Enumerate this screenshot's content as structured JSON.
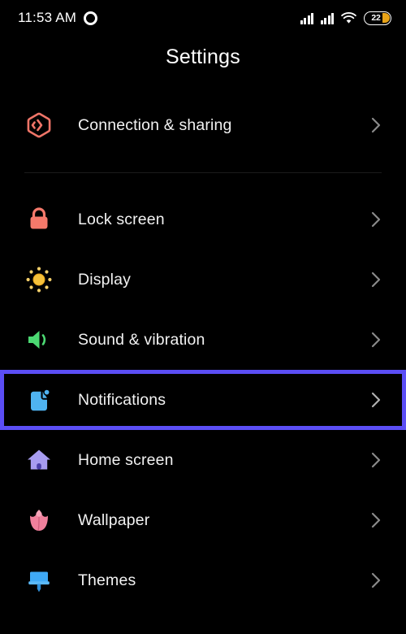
{
  "statusbar": {
    "time": "11:53 AM",
    "camera_icon": "camera-punch-hole-icon",
    "signal1_icon": "cellular-signal-icon",
    "signal2_icon": "cellular-signal-icon",
    "wifi_icon": "wifi-icon",
    "battery_level": "22",
    "battery_icon": "battery-icon",
    "battery_color": "#e8a317"
  },
  "header": {
    "title": "Settings"
  },
  "theme": {
    "background": "#000000",
    "text": "#f2f2f2",
    "highlight": "#5b4ef5",
    "divider": "#1b1b1b",
    "chevron": "#8a8a8a"
  },
  "list": {
    "groups": [
      {
        "items": [
          {
            "label": "Connection & sharing",
            "icon": "connection-sharing-icon",
            "icon_color": "#ef7568",
            "chevron": "chevron-right-icon",
            "selected": false
          }
        ]
      },
      {
        "items": [
          {
            "label": "Lock screen",
            "icon": "lock-icon",
            "icon_color": "#f4796b",
            "chevron": "chevron-right-icon",
            "selected": false
          },
          {
            "label": "Display",
            "icon": "brightness-sun-icon",
            "icon_color": "#f5c13b",
            "chevron": "chevron-right-icon",
            "selected": false
          },
          {
            "label": "Sound & vibration",
            "icon": "speaker-volume-icon",
            "icon_color": "#4cd973",
            "chevron": "chevron-right-icon",
            "selected": false
          },
          {
            "label": "Notifications",
            "icon": "notification-badge-icon",
            "icon_color": "#4fb3f0",
            "chevron": "chevron-right-icon",
            "selected": true
          },
          {
            "label": "Home screen",
            "icon": "home-house-icon",
            "icon_color": "#a79cf0",
            "chevron": "chevron-right-icon",
            "selected": false
          },
          {
            "label": "Wallpaper",
            "icon": "flower-tulip-icon",
            "icon_color": "#f0809c",
            "chevron": "chevron-right-icon",
            "selected": false
          },
          {
            "label": "Themes",
            "icon": "paint-brush-icon",
            "icon_color": "#3fa9f5",
            "chevron": "chevron-right-icon",
            "selected": false
          }
        ]
      }
    ]
  }
}
